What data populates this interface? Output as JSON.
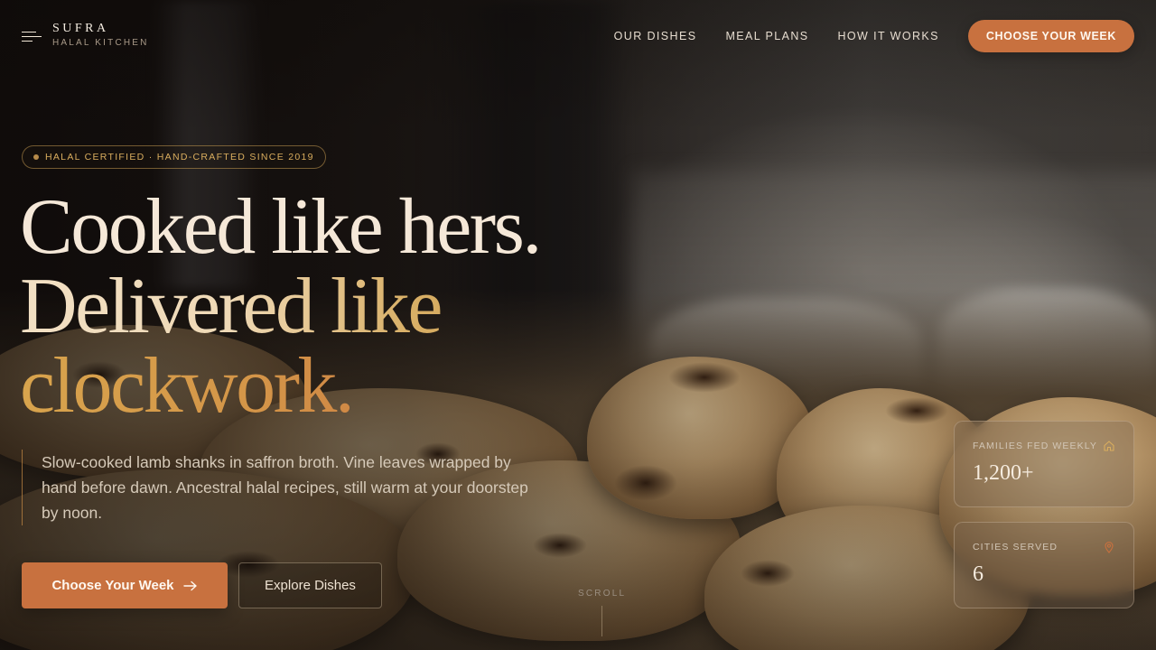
{
  "brand": {
    "name": "SUFRA",
    "tagline": "HALAL KITCHEN"
  },
  "nav": {
    "links": [
      "OUR DISHES",
      "MEAL PLANS",
      "HOW IT WORKS"
    ],
    "cta": "CHOOSE YOUR WEEK"
  },
  "hero": {
    "badge": "HALAL CERTIFIED · HAND-CRAFTED SINCE 2019",
    "headline_line1": "Cooked like hers.",
    "headline_line2": "Delivered like",
    "headline_line3": "clockwork.",
    "lede": "Slow-cooked lamb shanks in saffron broth. Vine leaves wrapped by hand before dawn. Ancestral halal recipes, still warm at your doorstep by noon.",
    "primary_button": "Choose Your Week",
    "secondary_button": "Explore Dishes",
    "scroll_label": "SCROLL"
  },
  "stats": [
    {
      "label": "FAMILIES FED WEEKLY",
      "value": "1,200+",
      "icon": "home-icon"
    },
    {
      "label": "CITIES SERVED",
      "value": "6",
      "icon": "map-pin-icon"
    }
  ],
  "colors": {
    "accent": "#c8713f",
    "gold": "#d9ad5e",
    "cream": "#f5e8d8"
  }
}
